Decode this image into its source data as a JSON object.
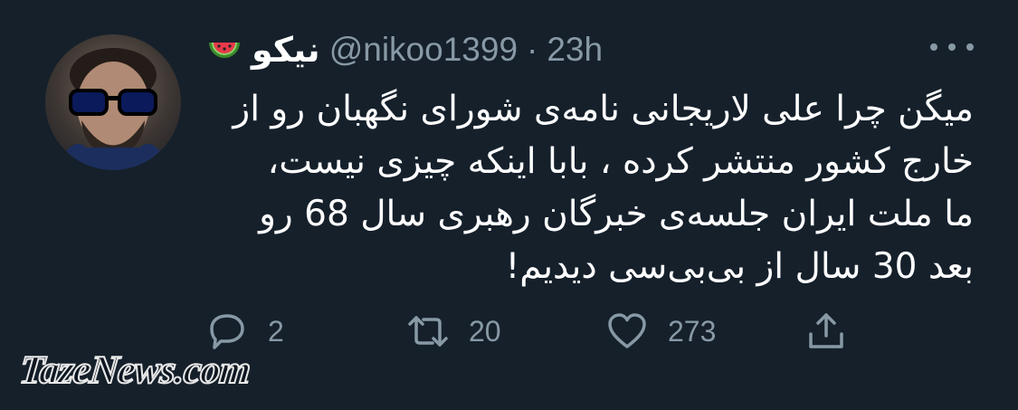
{
  "tweet": {
    "display_name": "نیکو",
    "handle": "@nikoo1399",
    "separator": "·",
    "time": "23h",
    "body_lines": [
      "میگن چرا علی لاریجانی نامه‌ی شورای نگهبان رو از",
      "خارج کشور منتشر کرده ، بابا اینکه چیزی نیست،",
      "ما ملت ایران جلسه‌ی خبرگان رهبری سال 68 رو",
      "بعد 30 سال از بی‌بی‌سی دیدیم!"
    ],
    "reply_count": "2",
    "retweet_count": "20",
    "like_count": "273"
  },
  "icons": {
    "name_emoji": "watermelon-icon",
    "more": "more-dots-icon",
    "reply": "reply-icon",
    "retweet": "retweet-icon",
    "like": "heart-icon",
    "share": "share-icon"
  },
  "colors": {
    "background": "#15202b",
    "secondary_text": "#8899a6",
    "primary_text": "#ffffff"
  },
  "watermark": "TazeNews.com"
}
